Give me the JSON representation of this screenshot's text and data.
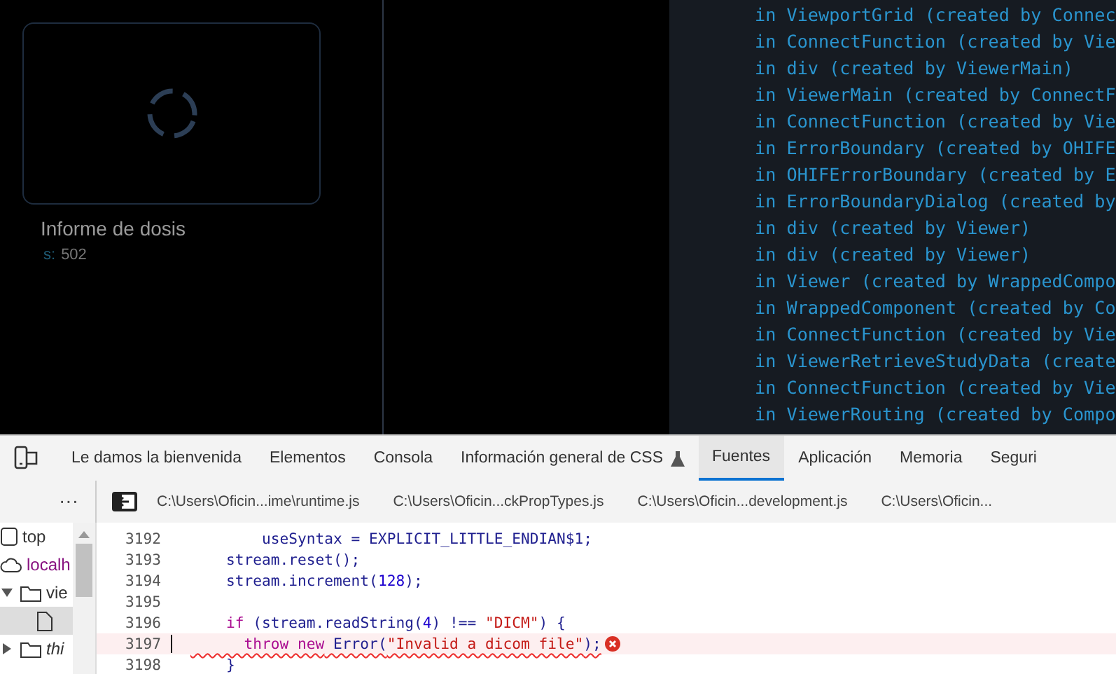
{
  "study_card": {
    "title": "Informe de dosis",
    "series_label": "s:",
    "series_value": "502",
    "loading": true
  },
  "console_lines": [
    "in ViewportGrid (created by Connec",
    "in ConnectFunction (created by Vie",
    "in div (created by ViewerMain)",
    "in ViewerMain (created by ConnectF",
    "in ConnectFunction (created by Vie",
    "in ErrorBoundary (created by OHIFE",
    "in OHIFErrorBoundary (created by E",
    "in ErrorBoundaryDialog (created by",
    "in div (created by Viewer)",
    "in div (created by Viewer)",
    "in Viewer (created by WrappedCompo",
    "in WrappedComponent (created by Co",
    "in ConnectFunction (created by Vie",
    "in ViewerRetrieveStudyData (create",
    "in ConnectFunction (created by Vie",
    "in ViewerRouting (created by Compo"
  ],
  "devtools": {
    "tabs": [
      {
        "label": "Le damos la bienvenida",
        "selected": false
      },
      {
        "label": "Elementos",
        "selected": false
      },
      {
        "label": "Consola",
        "selected": false
      },
      {
        "label": "Información general de CSS",
        "selected": false,
        "experimental": true
      },
      {
        "label": "Fuentes",
        "selected": true
      },
      {
        "label": "Aplicación",
        "selected": false
      },
      {
        "label": "Memoria",
        "selected": false
      },
      {
        "label": "Seguri",
        "selected": false
      }
    ],
    "more": "···",
    "file_tabs": [
      "C:\\Users\\Oficin...ime\\runtime.js",
      "C:\\Users\\Oficin...ckPropTypes.js",
      "C:\\Users\\Oficin...development.js",
      "C:\\Users\\Oficin..."
    ],
    "tree": [
      {
        "kind": "frame",
        "label": "top",
        "italic": false,
        "selected": false
      },
      {
        "kind": "cloud",
        "label": "localh",
        "italic": false,
        "selected": false
      },
      {
        "kind": "folder",
        "label": "vie",
        "expanded": true,
        "italic": false,
        "selected": false
      },
      {
        "kind": "file",
        "selected": true
      },
      {
        "kind": "folder",
        "label": "thi",
        "expanded": false,
        "italic": true,
        "selected": false
      }
    ],
    "code": [
      {
        "line": "3192",
        "error": false,
        "tokens": [
          {
            "text": "        useSyntax = EXPLICIT_LITTLE_ENDIAN$1;",
            "kind": "plain"
          }
        ]
      },
      {
        "line": "3193",
        "error": false,
        "tokens": [
          {
            "text": "    stream.reset();",
            "kind": "plain"
          }
        ]
      },
      {
        "line": "3194",
        "error": false,
        "tokens": [
          {
            "text": "    stream.increment(",
            "kind": "plain"
          },
          {
            "text": "128",
            "kind": "number"
          },
          {
            "text": ");",
            "kind": "plain"
          }
        ]
      },
      {
        "line": "3195",
        "error": false
      },
      {
        "line": "3196",
        "error": false,
        "tokens": [
          {
            "text": "    if",
            "kind": "keyword"
          },
          {
            "text": " (stream.readString(",
            "kind": "plain"
          },
          {
            "text": "4",
            "kind": "number"
          },
          {
            "text": ") !== ",
            "kind": "plain"
          },
          {
            "text": "\"DICM\"",
            "kind": "string"
          },
          {
            "text": ") {",
            "kind": "plain"
          }
        ]
      },
      {
        "line": "3197",
        "error": true,
        "tokens": [
          {
            "text": "      throw new",
            "kind": "keyword"
          },
          {
            "text": " Error(",
            "kind": "plain"
          },
          {
            "text": "\"Invalid a dicom file\"",
            "kind": "string"
          },
          {
            "text": ");",
            "kind": "plain"
          }
        ]
      },
      {
        "line": "3198",
        "error": false,
        "tokens": [
          {
            "text": "    }",
            "kind": "plain"
          }
        ]
      }
    ]
  }
}
